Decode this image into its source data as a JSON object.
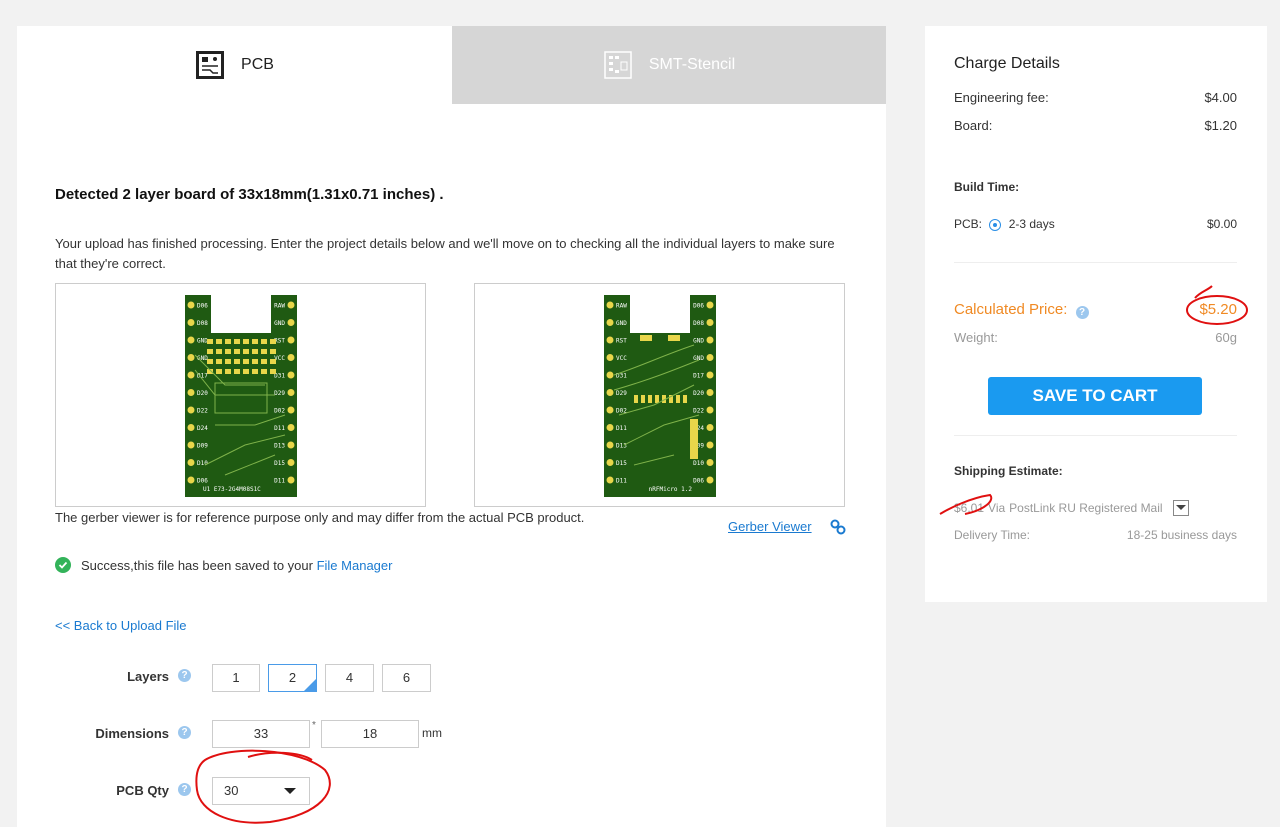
{
  "tabs": [
    {
      "label": "PCB",
      "icon": "pcb-icon",
      "active": true
    },
    {
      "label": "SMT-Stencil",
      "icon": "stencil-icon",
      "active": false
    }
  ],
  "detected": "Detected 2 layer board of 33x18mm(1.31x0.71 inches) .",
  "description": "Your upload has finished processing. Enter the project details below and we'll move on to checking all the individual layers to make sure that they're correct.",
  "previews": {
    "top": {
      "label": "U1 E73-2G4M08S1C",
      "pins_left": [
        "D06",
        "D08",
        "GND",
        "GND",
        "D17",
        "D20",
        "D22",
        "D24",
        "D09",
        "D10",
        "D06"
      ],
      "pins_right": [
        "RAW",
        "GND",
        "RST",
        "VCC",
        "D31",
        "D29",
        "D02",
        "D11",
        "D13",
        "D15",
        "D11"
      ]
    },
    "bottom": {
      "label": "nRFMicro 1.2",
      "pins_left": [
        "RAW",
        "GND",
        "RST",
        "VCC",
        "D31",
        "D29",
        "D02",
        "D11",
        "D13",
        "D15",
        "D11"
      ],
      "pins_right": [
        "D06",
        "D08",
        "GND",
        "GND",
        "D17",
        "D20",
        "D22",
        "D24",
        "D09",
        "D10",
        "D06"
      ]
    }
  },
  "viewer_note": "The gerber viewer is for reference purpose only and may differ from the actual PCB product.",
  "gerber_link": "Gerber Viewer",
  "success_text": "Success,this file has been saved to your",
  "file_manager": "File Manager",
  "back_link": "<< Back to Upload File",
  "form": {
    "layers_label": "Layers",
    "layer_options": [
      "1",
      "2",
      "4",
      "6"
    ],
    "layer_selected": "2",
    "dimensions_label": "Dimensions",
    "dim_x": "33",
    "dim_y": "18",
    "dim_sep": "*",
    "dim_unit": "mm",
    "qty_label": "PCB Qty",
    "qty_value": "30",
    "help": "?"
  },
  "charge": {
    "title": "Charge Details",
    "engineering_label": "Engineering fee:",
    "engineering_value": "$4.00",
    "board_label": "Board:",
    "board_value": "$1.20",
    "build_time_label": "Build Time:",
    "build_pcb_label": "PCB:",
    "build_pcb_option": "2-3 days",
    "build_pcb_value": "$0.00",
    "calc_label": "Calculated Price:",
    "calc_value": "$5.20",
    "weight_label": "Weight:",
    "weight_value": "60g",
    "save_button": "SAVE TO CART",
    "shipping_title": "Shipping Estimate:",
    "shipping_price": "$6.01",
    "shipping_via": "Via",
    "shipping_method": "PostLink RU Registered Mail",
    "delivery_label": "Delivery Time:",
    "delivery_value": "18-25 business days"
  },
  "colors": {
    "accent": "#1a9af0",
    "link": "#1a7ad0",
    "price": "#f08a24",
    "pcb_green": "#1f5a12",
    "annotation_red": "#e01010"
  }
}
